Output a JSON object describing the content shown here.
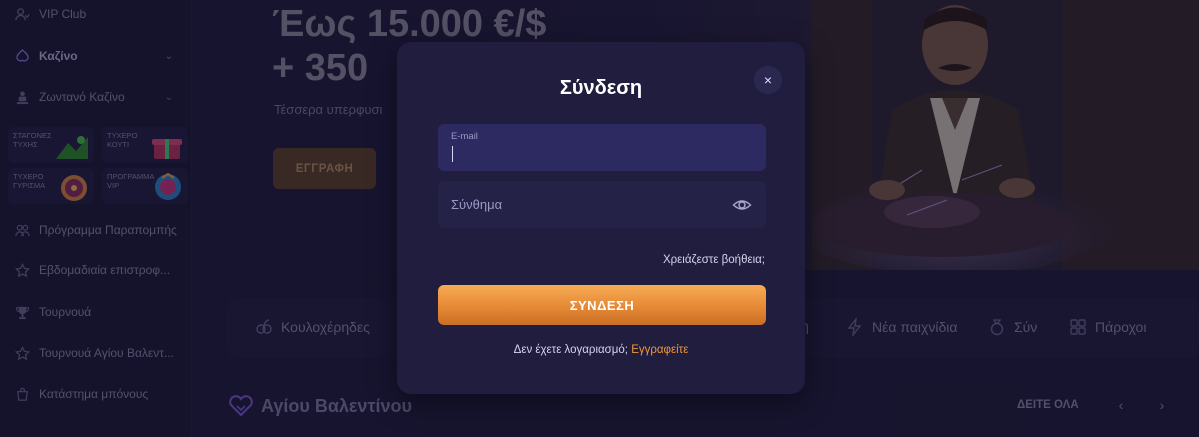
{
  "sidebar": {
    "items": [
      {
        "label": "VIP Club",
        "icon": "vip-icon"
      },
      {
        "label": "Καζίνο",
        "icon": "casino-icon",
        "active": true,
        "expandable": true
      },
      {
        "label": "Ζωντανό Καζίνο",
        "icon": "live-casino-icon",
        "expandable": true
      },
      {
        "label": "Πρόγραμμα Παραπομπής",
        "icon": "referral-icon"
      },
      {
        "label": "Εβδομαδιαία επιστροφ...",
        "icon": "star-icon"
      },
      {
        "label": "Τουρνουά",
        "icon": "trophy-icon"
      },
      {
        "label": "Τουρνουά Αγίου Βαλεντ...",
        "icon": "star-icon"
      },
      {
        "label": "Κατάστημα μπόνους",
        "icon": "shop-icon"
      }
    ],
    "promo_tiles": [
      {
        "label": "ΣΤΑΓΟΝΕΣ ΤΥΧΗΣ"
      },
      {
        "label": "ΤΥΧΕΡΟ ΚΟΥΤΙ"
      },
      {
        "label": "ΤΥΧΕΡΟ ΓΥΡΙΣΜΑ"
      },
      {
        "label": "ΠΡΟΓΡΑΜΜΑ VIP"
      }
    ]
  },
  "hero": {
    "title": "Έως 15.000 €/$\n+ 350",
    "subtitle": "Τέσσερα υπερφυσι",
    "button": "ΕΓΓΡΑΦΗ"
  },
  "categories": [
    {
      "label": "Κουλοχέρηδες",
      "icon": "slots-icon"
    },
    {
      "label": "η",
      "icon": ""
    },
    {
      "label": "Νέα παιχνίδια",
      "icon": "lightning-icon"
    },
    {
      "label": "Σύν",
      "icon": "bag-icon"
    },
    {
      "label": "Πάροχοι",
      "icon": "grid-icon"
    }
  ],
  "section": {
    "title": "Αγίου Βαλεντίνου",
    "see_all": "ΔΕΙΤΕ ΟΛΑ",
    "prev": "‹",
    "next": "›"
  },
  "modal": {
    "title": "Σύνδεση",
    "close": "×",
    "email_label": "E-mail",
    "email_value": "",
    "password_placeholder": "Σύνθημα",
    "help_link": "Χρειάζεστε βοήθεια;",
    "login_button": "ΣΥΝΔΕΣΗ",
    "no_account_text": "Δεν έχετε λογαριασμό;",
    "register_link": "Εγγραφείτε"
  },
  "colors": {
    "background": "#1f1c3c",
    "accent": "#f0963f",
    "modal_bg": "#201d3e"
  }
}
